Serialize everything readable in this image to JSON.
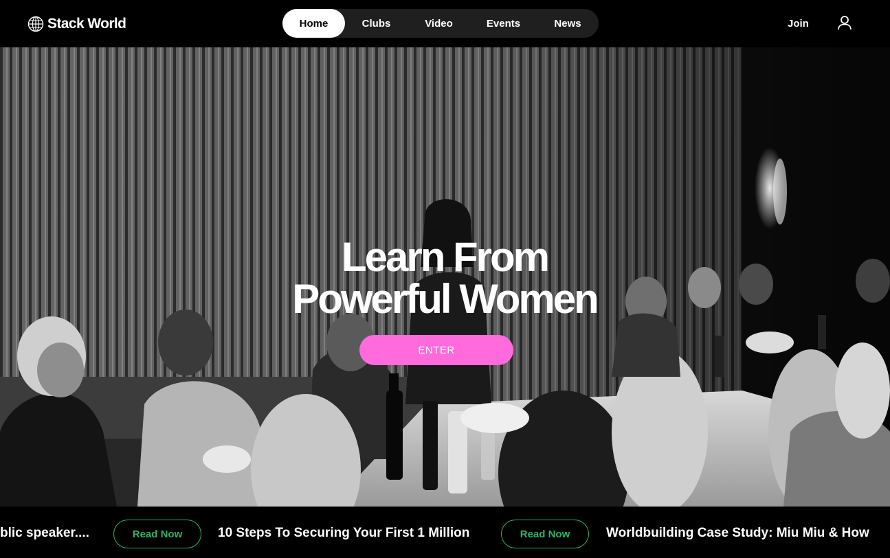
{
  "brand": {
    "name": "Stack World",
    "icon": "globe-icon"
  },
  "nav": {
    "items": [
      {
        "label": "Home",
        "active": true
      },
      {
        "label": "Clubs",
        "active": false
      },
      {
        "label": "Video",
        "active": false
      },
      {
        "label": "Events",
        "active": false
      },
      {
        "label": "News",
        "active": false
      }
    ]
  },
  "header": {
    "join_label": "Join",
    "account_icon": "user-icon"
  },
  "hero": {
    "title_line1": "Learn From",
    "title_line2": "Powerful Women",
    "cta_label": "ENTER",
    "cta_color": "#ff6bdc",
    "image": "black-and-white photo of women dining at a long table"
  },
  "ticker": {
    "items": [
      {
        "title": "blic speaker....",
        "button": "Read Now"
      },
      {
        "title": "10 Steps To Securing Your First 1 Million",
        "button": "Read Now"
      },
      {
        "title": "Worldbuilding Case Study: Miu Miu & How",
        "button": "Read Now"
      }
    ],
    "accent": "#2db36a"
  }
}
